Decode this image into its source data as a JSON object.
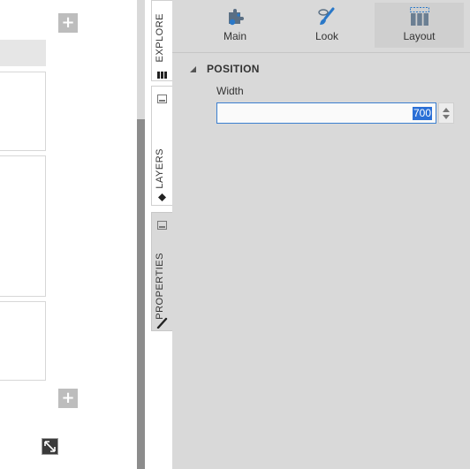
{
  "canvas": {
    "add_label": "+"
  },
  "sidebar_tabs": [
    {
      "label": "EXPLORE",
      "icon": "explore-icon"
    },
    {
      "label": "LAYERS",
      "icon": "layers-icon"
    },
    {
      "label": "PROPERTIES",
      "icon": "brush-icon"
    }
  ],
  "toolbar": {
    "items": [
      {
        "label": "Main",
        "icon": "puzzle-icon"
      },
      {
        "label": "Look",
        "icon": "paintbrush-icon"
      },
      {
        "label": "Layout",
        "icon": "columns-layout-icon"
      }
    ],
    "active": "Layout"
  },
  "position": {
    "title": "POSITION",
    "width_label": "Width",
    "width_value": "700"
  },
  "colors": {
    "panel_bg": "#d9d9d9",
    "accent": "#2a6fd6",
    "icon_blue": "#2a78c8"
  }
}
